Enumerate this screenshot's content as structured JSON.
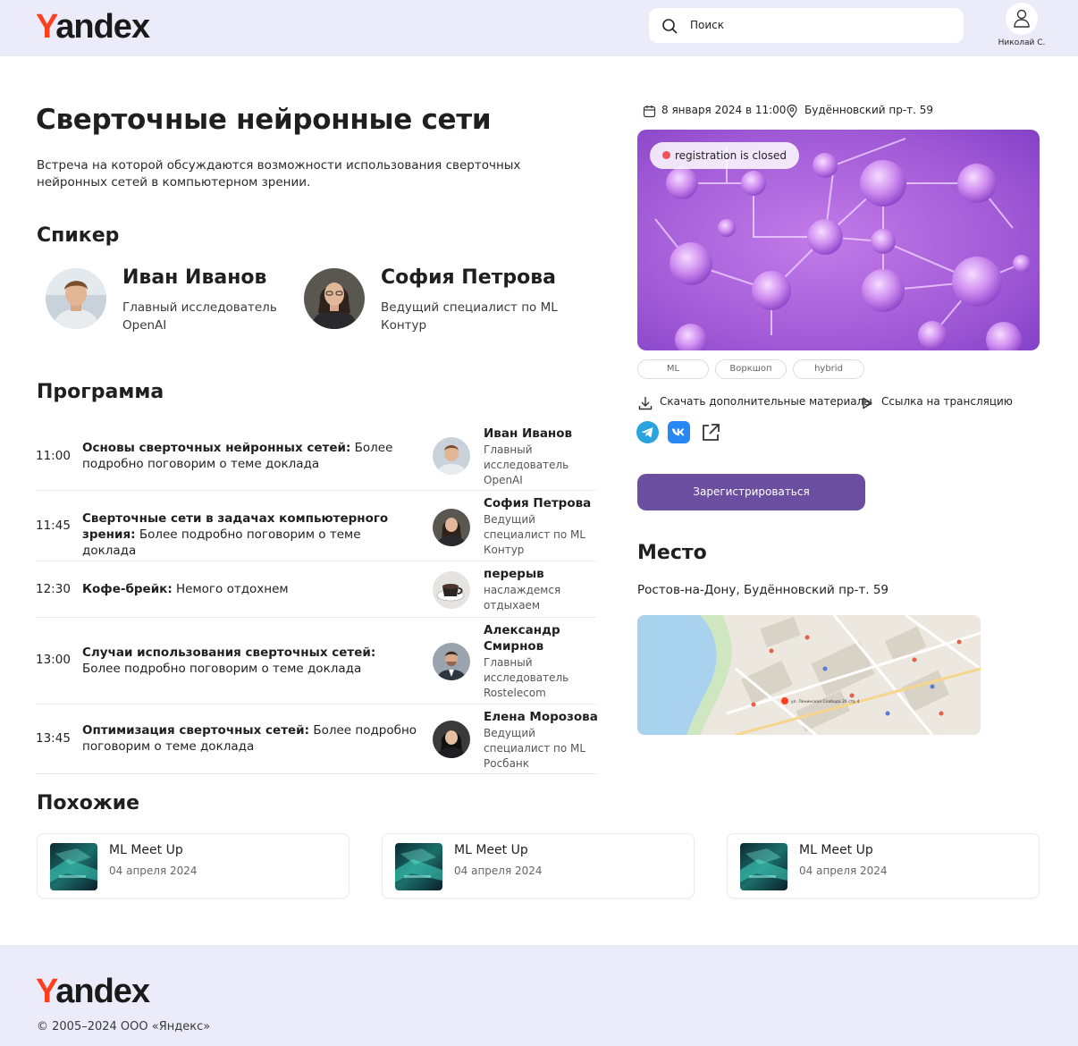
{
  "header": {
    "logo_first": "Y",
    "logo_rest": "andex",
    "search_placeholder": "Поиск",
    "user_name": "Николай С."
  },
  "event": {
    "title": "Сверточные нейронные сети",
    "description": "Встреча на которой обсуждаются возможности использования сверточных нейронных сетей в компьютерном зрении.",
    "date": "8 января 2024 в 11:00",
    "location": "Будённовский пр-т. 59",
    "registration_badge": "registration is closed",
    "tags": [
      "ML",
      "Воркшоп",
      "hybrid"
    ],
    "download_link": "Скачать дополнительные материалы",
    "stream_link": "Ссылка на трансляцию",
    "register_button": "Зарегистрироваться"
  },
  "speakers_section": {
    "heading": "Спикер",
    "speakers": [
      {
        "name": "Иван Иванов",
        "role": "Главный исследователь",
        "company": "OpenAI"
      },
      {
        "name": "София Петрова",
        "role": "Ведущий специалист по ML",
        "company": "Контур"
      }
    ]
  },
  "program": {
    "heading": "Программа",
    "items": [
      {
        "time": "11:00",
        "topic": "Основы сверточных нейронных сетей:",
        "details": " Более подробно поговорим о теме доклада",
        "speaker": "Иван Иванов",
        "speaker_info": "Главный исследователь OpenAI"
      },
      {
        "time": "11:45",
        "topic": "Сверточные сети в задачах компьютерного зрения:",
        "details": " Более подробно поговорим о теме доклада",
        "speaker": "София Петрова",
        "speaker_info": "Ведущий специалист по ML Контур"
      },
      {
        "time": "12:30",
        "topic": "Кофе-брейк:",
        "details": " Немого отдохнем",
        "speaker": "перерыв",
        "speaker_info": "наслаждемся отдыхаем"
      },
      {
        "time": "13:00",
        "topic": "Случаи использования сверточных сетей:",
        "details": " Более подробно поговорим о теме доклада",
        "speaker": "Александр Смирнов",
        "speaker_info": "Главный исследователь Rostelecom"
      },
      {
        "time": "13:45",
        "topic": "Оптимизация сверточных сетей:",
        "details": " Более подробно поговорим о теме доклада",
        "speaker": "Елена Морозова",
        "speaker_info": "Ведущий специалист по ML Росбанк"
      }
    ]
  },
  "place": {
    "heading": "Место",
    "address": "Ростов-на-Дону, Будённовский пр-т. 59",
    "map_street_label": "ул. Ленинская Слобода 26 стр 4"
  },
  "similar": {
    "heading": "Похожие",
    "items": [
      {
        "title": "ML Meet Up",
        "date": "04 апреля 2024"
      },
      {
        "title": "ML Meet Up",
        "date": "04 апреля 2024"
      },
      {
        "title": "ML Meet Up",
        "date": "04 апреля 2024"
      }
    ]
  },
  "footer": {
    "logo_first": "Y",
    "logo_rest": "andex",
    "copyright": "© 2005–2024 ООО «Яндекс»"
  },
  "colors": {
    "header_bg": "#ebebf9",
    "brand_red": "#fc3f1d",
    "button": "#6b4ea0",
    "badge_dot": "#f0505a",
    "telegram": "#2aa3df",
    "vk": "#2787f5"
  },
  "icons": [
    "search-icon",
    "user-icon",
    "calendar-icon",
    "location-pin-icon",
    "download-icon",
    "play-icon",
    "telegram-icon",
    "vk-icon",
    "external-link-icon"
  ]
}
